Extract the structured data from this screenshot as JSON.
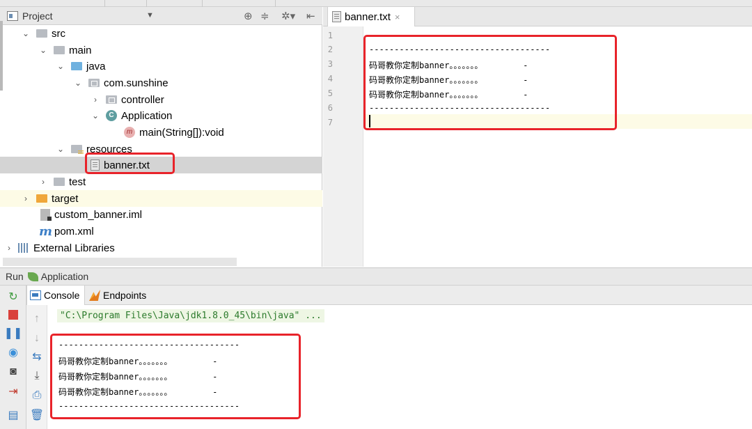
{
  "project_panel": {
    "title": "Project",
    "dropdown_icon": "triangle-down",
    "tree": {
      "src": "src",
      "main": "main",
      "java": "java",
      "package": "com.sunshine",
      "controller": "controller",
      "application": "Application",
      "method": "main(String[]):void",
      "resources": "resources",
      "banner": "banner.txt",
      "test": "test",
      "target": "target",
      "iml": "custom_banner.iml",
      "pom": "pom.xml",
      "libraries": "External Libraries"
    }
  },
  "editor": {
    "tab_label": "banner.txt",
    "tab_close": "×",
    "line_numbers": [
      "1",
      "2",
      "3",
      "4",
      "5",
      "6",
      "7"
    ],
    "lines": [
      "",
      "------------------------------------",
      "码哥教你定制banner。。。。。。。        -",
      "码哥教你定制banner。。。。。。。        -",
      "码哥教你定制banner。。。。。。。        -",
      "------------------------------------",
      ""
    ]
  },
  "run": {
    "label": "Run",
    "config": "Application",
    "tabs": {
      "console": "Console",
      "endpoints": "Endpoints"
    },
    "command": "\"C:\\Program Files\\Java\\jdk1.8.0_45\\bin\\java\" ...",
    "output": [
      "------------------------------------",
      "码哥教你定制banner。。。。。。。        -",
      "码哥教你定制banner。。。。。。。        -",
      "码哥教你定制banner。。。。。。。        -",
      "------------------------------------"
    ]
  },
  "colors": {
    "highlight_red": "#e8232a",
    "selection_gray": "#d4d4d4",
    "current_line": "#fdfbe6",
    "command_green": "#2b7a2b"
  }
}
